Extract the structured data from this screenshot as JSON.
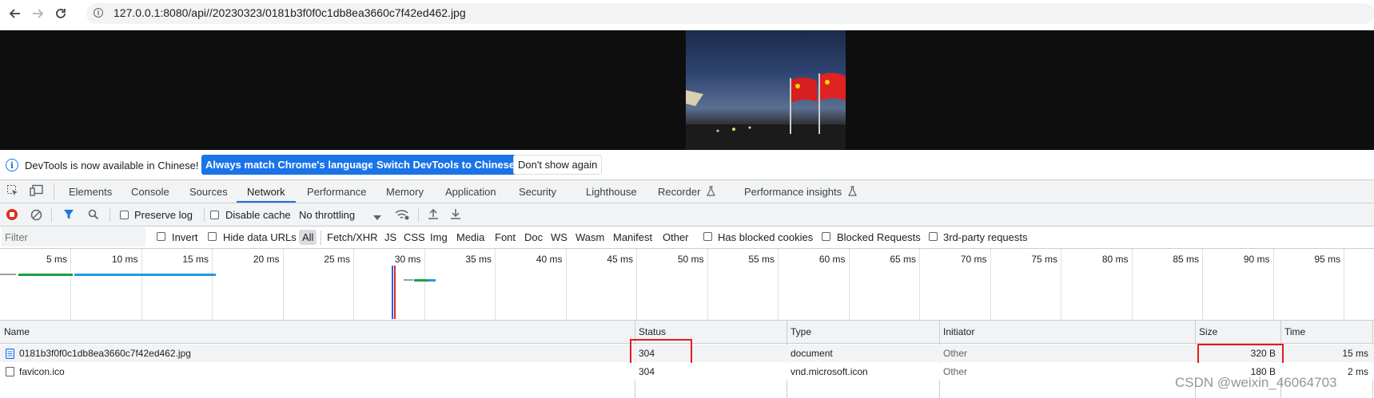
{
  "browser": {
    "url": "127.0.0.1:8080/api//20230323/0181b3f0f0c1db8ea3660c7f42ed462.jpg"
  },
  "infobar": {
    "message": "DevTools is now available in Chinese!",
    "btn_match": "Always match Chrome's language",
    "btn_switch": "Switch DevTools to Chinese",
    "btn_dontshow": "Don't show again"
  },
  "tabs": [
    "Elements",
    "Console",
    "Sources",
    "Network",
    "Performance",
    "Memory",
    "Application",
    "Security",
    "Lighthouse",
    "Recorder",
    "Performance insights"
  ],
  "active_tab": "Network",
  "toolbar": {
    "preserve_log": "Preserve log",
    "disable_cache": "Disable cache",
    "throttling": "No throttling"
  },
  "filterbar": {
    "placeholder": "Filter",
    "invert": "Invert",
    "hide_data_urls": "Hide data URLs",
    "types": [
      "All",
      "Fetch/XHR",
      "JS",
      "CSS",
      "Img",
      "Media",
      "Font",
      "Doc",
      "WS",
      "Wasm",
      "Manifest",
      "Other"
    ],
    "has_blocked_cookies": "Has blocked cookies",
    "blocked_requests": "Blocked Requests",
    "third_party": "3rd-party requests"
  },
  "timeline": {
    "ticks": [
      "5 ms",
      "10 ms",
      "15 ms",
      "20 ms",
      "25 ms",
      "30 ms",
      "35 ms",
      "40 ms",
      "45 ms",
      "50 ms",
      "55 ms",
      "60 ms",
      "65 ms",
      "70 ms",
      "75 ms",
      "80 ms",
      "85 ms",
      "90 ms",
      "95 ms"
    ]
  },
  "table": {
    "headers": {
      "name": "Name",
      "status": "Status",
      "type": "Type",
      "initiator": "Initiator",
      "size": "Size",
      "time": "Time"
    },
    "rows": [
      {
        "name": "0181b3f0f0c1db8ea3660c7f42ed462.jpg",
        "status": "304",
        "type": "document",
        "initiator": "Other",
        "size": "320 B",
        "time": "15 ms"
      },
      {
        "name": "favicon.ico",
        "status": "304",
        "type": "vnd.microsoft.icon",
        "initiator": "Other",
        "size": "180 B",
        "time": "2 ms"
      }
    ]
  },
  "watermark": "CSDN @weixin_46064703",
  "colors": {
    "accent": "#1a73e8",
    "highlight": "#e11d1d"
  }
}
